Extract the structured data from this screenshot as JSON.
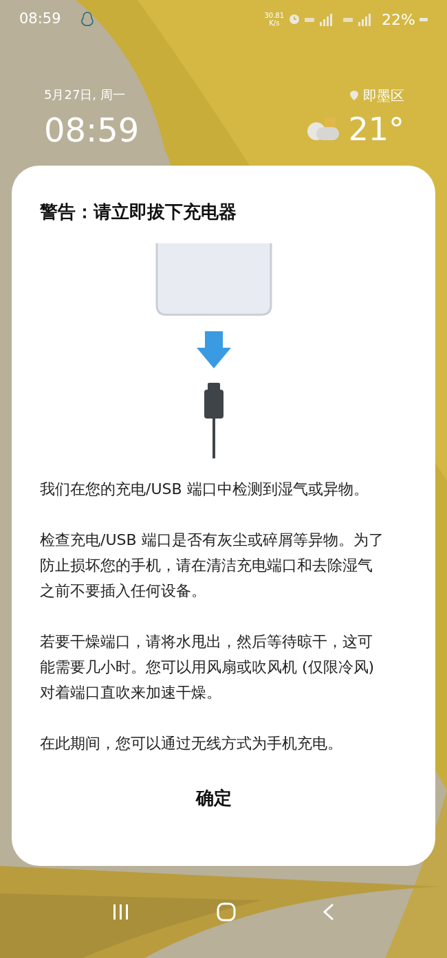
{
  "status_bar": {
    "time": "08:59",
    "net_speed": [
      "30.81",
      "K/s"
    ],
    "battery": "22%"
  },
  "lock_screen": {
    "date": "5月27日, 周一",
    "clock": "08:59",
    "location": "即墨区",
    "temperature": "21°"
  },
  "dialog": {
    "title": "警告：请立即拔下充电器",
    "paragraphs": [
      "我们在您的充电/USB 端口中检测到湿气或异物。",
      "检查充电/USB 端口是否有灰尘或碎屑等异物。为了防止损坏您的手机，请在清洁充电端口和去除湿气之前不要插入任何设备。",
      "若要干燥端口，请将水甩出，然后等待晾干，这可能需要几小时。您可以用风扇或吹风机 (仅限冷风) 对着端口直吹来加速干燥。",
      "在此期间，您可以通过无线方式为手机充电。"
    ],
    "button": "确定"
  }
}
